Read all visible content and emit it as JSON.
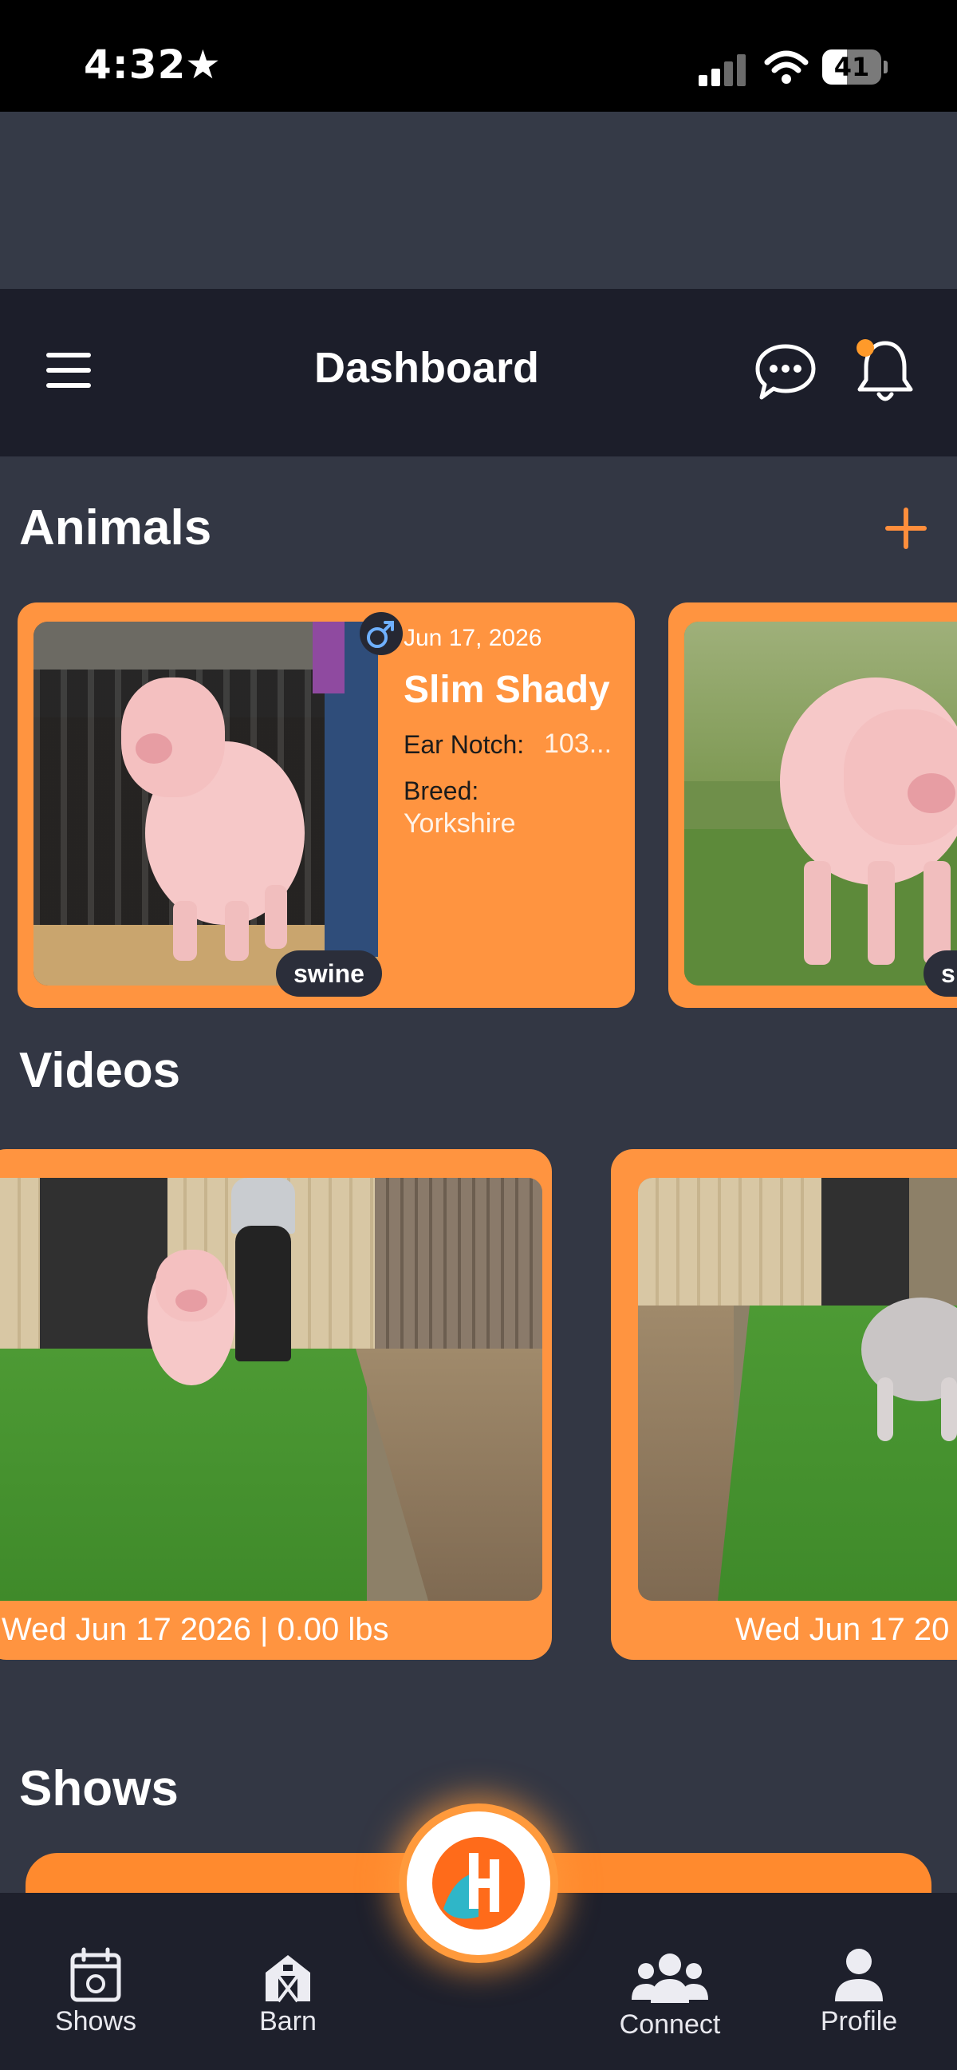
{
  "status_bar": {
    "time": "4:32",
    "battery": "41"
  },
  "header": {
    "title": "Dashboard"
  },
  "animals": {
    "title": "Animals",
    "cards": [
      {
        "date": "Jun 17, 2026",
        "name": "Slim Shady",
        "ear_notch_label": "Ear Notch:",
        "ear_notch_value": "103...",
        "breed_label": "Breed:",
        "breed_value": "Yorkshire",
        "tag": "swine"
      }
    ],
    "second_card_tag": "s"
  },
  "videos": {
    "title": "Videos",
    "items": [
      {
        "caption": "Wed Jun 17 2026 | 0.00 lbs"
      },
      {
        "caption": "Wed Jun 17 20"
      }
    ]
  },
  "shows": {
    "title": "Shows"
  },
  "nav": {
    "items": [
      {
        "label": "Shows"
      },
      {
        "label": "Barn"
      },
      {
        "label": "Connect"
      },
      {
        "label": "Profile"
      }
    ]
  },
  "colors": {
    "accent": "#ff9440",
    "background": "#333744",
    "header": "#1c1e2a",
    "nav": "#1e202c",
    "logo_orange": "#ff6b1a",
    "logo_teal": "#2fb6c8"
  }
}
